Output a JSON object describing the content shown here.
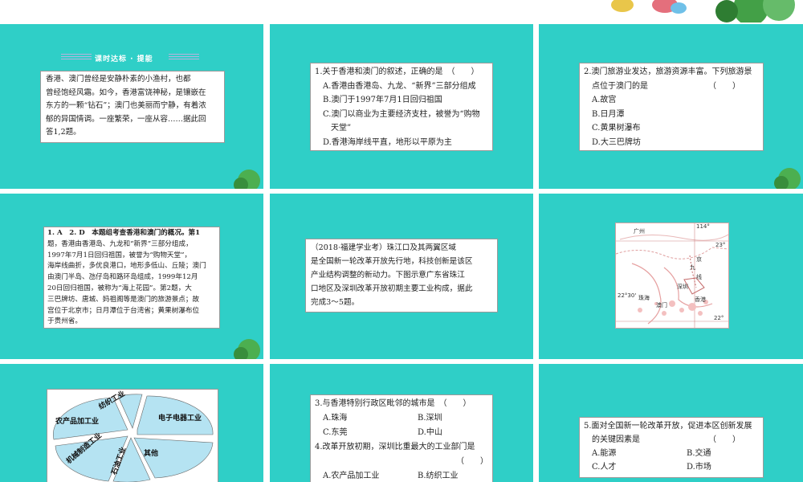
{
  "colors": {
    "panel": "#2fcfc7",
    "header_stripe": "#b9b2de",
    "tree_green": "#4caf50"
  },
  "slide1": {
    "heading": "课时达标 · 提能",
    "lines": [
      "香港、澳门曾经是安静朴素的小渔村，也都",
      "曾经饱经风霜。如今，香港富饶神秘，是镶嵌在",
      "东方的一颗“钻石”；澳门也美丽而宁静，有着浓",
      "郁的异国情调。一座繁荣，一座从容……据此回",
      "答1,2题。"
    ]
  },
  "slide2": {
    "lines": [
      "1.关于香港和澳门的叙述，正确的是　（　　）",
      "A.香港由香港岛、九龙、“新界”三部分组成",
      "B.澳门于1997年7月1日回归祖国",
      "C.澳门以商业为主要经济支柱，被誉为“购物",
      "　天堂”",
      "D.香港海岸线平直，地形以平原为主"
    ]
  },
  "slide3": {
    "lines": [
      "2.澳门旅游业发达，旅游资源丰富。下列旅游景",
      "　点位于澳门的是　　　　　　　　（　　）",
      "A.故宫",
      "B.日月潭",
      "C.黄果树瀑布",
      "D.大三巴牌坊"
    ]
  },
  "slide4": {
    "lines": [
      "1. A　2. D　本题组考查香港和澳门的概况。第1",
      "题，香港由香港岛、九龙和“新界”三部分组成，",
      "1997年7月1日回归祖国，被誉为“购物天堂”，",
      "海岸线曲折，多优良港口，地形多低山、丘陵；澳门",
      "由澳门半岛、氹仔岛和路环岛组成，1999年12月",
      "20日回归祖国，被称为“海上花园”。第2题，大",
      "三巴牌坊、唐城、妈祖阁等是澳门的旅游景点；故",
      "宫位于北京市；日月潭位于台湾省；黄果树瀑布位",
      "于贵州省。"
    ]
  },
  "slide5": {
    "lines": [
      "（2018·福建学业考）珠江口及其两翼区域",
      "是全国新一轮改革开放先行地，科技创新是该区",
      "产业结构调整的新动力。下图示意广东省珠江",
      "口地区及深圳改革开放初期主要工业构成，据此",
      "完成3～5题。"
    ]
  },
  "slide6": {
    "map_labels": {
      "guangzhou": "广州",
      "lon": "114°",
      "lat23": "23°",
      "lat2230": "22°30'",
      "lat22": "22°",
      "kowloon_a": "京",
      "kowloon_b": "九",
      "kowloon_c": "线",
      "shenzhen": "深圳",
      "zhuhai": "珠海",
      "macau": "澳门",
      "hongkong": "香港"
    }
  },
  "slide7": {
    "chart_data": {
      "type": "pie",
      "categories": [
        "纺织工业",
        "电子电器工业",
        "其他",
        "石油工业",
        "机械制造工业",
        "农产品加工业"
      ]
    }
  },
  "slide8": {
    "q3": "3.与香港特别行政区毗邻的城市是　（　　）",
    "q3_options": [
      [
        "A.珠海",
        "B.深圳"
      ],
      [
        "C.东莞",
        "D.中山"
      ]
    ],
    "q4": "4.改革开放初期，深圳比重最大的工业部门是",
    "q4_paren": "（　　）",
    "q4_options": [
      [
        "A.农产品加工业",
        "B.纺织工业"
      ]
    ]
  },
  "slide9": {
    "q5_line1": "5.面对全国新一轮改革开放，促进本区创新发展",
    "q5_line2": "　的关键因素是　　　　　　　　　（　　）",
    "q5_options": [
      [
        "A.能源",
        "B.交通"
      ],
      [
        "C.人才",
        "D.市场"
      ]
    ]
  }
}
